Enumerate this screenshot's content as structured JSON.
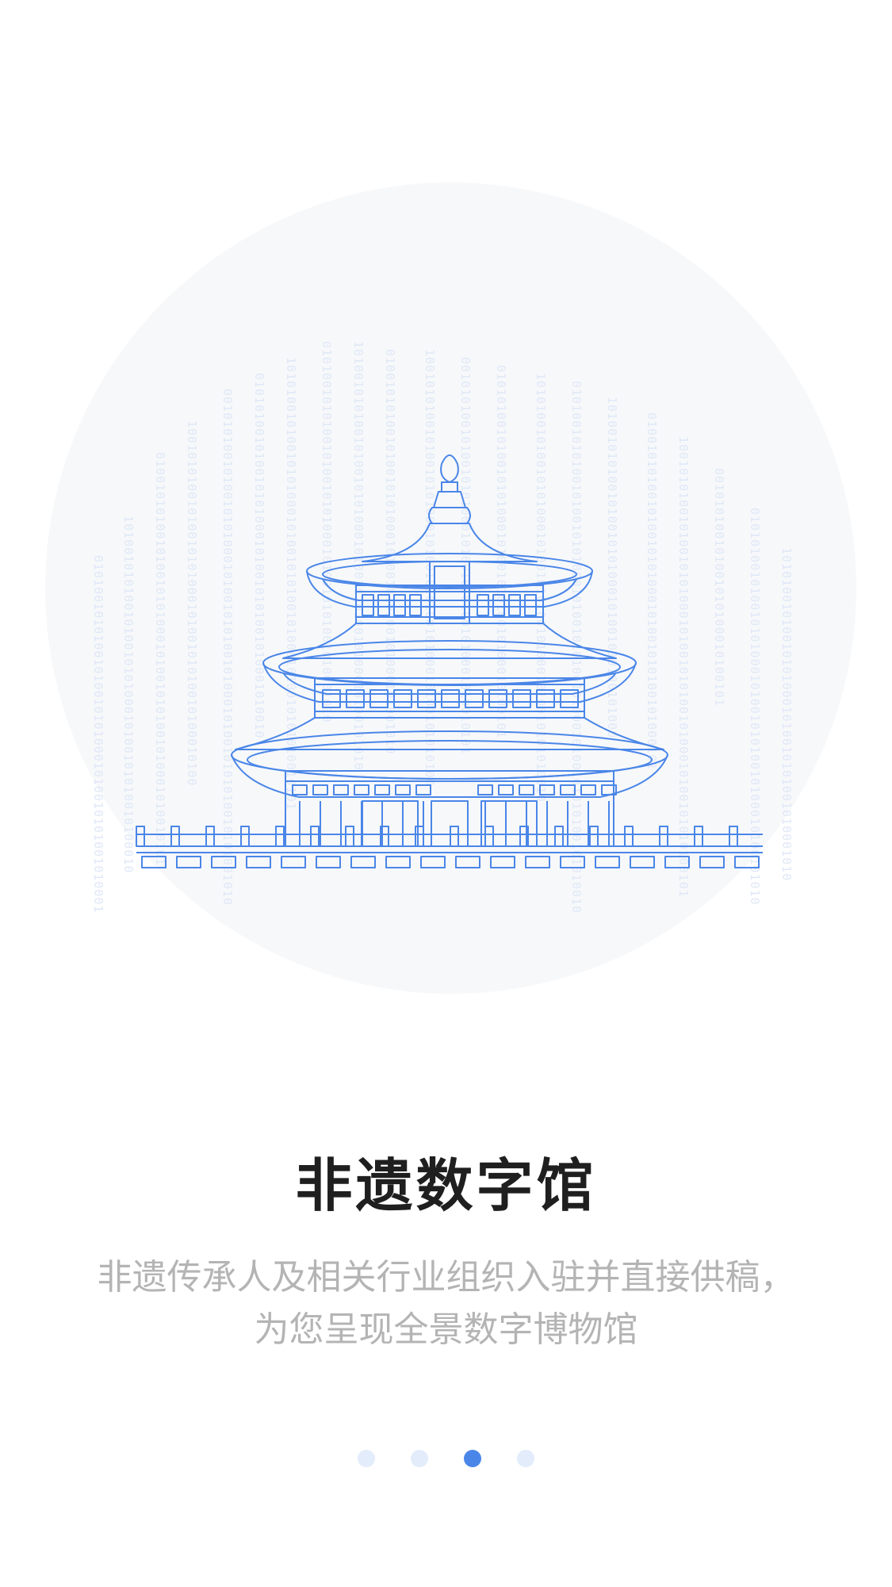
{
  "slide": {
    "title": "非遗数字馆",
    "subtitle_line1": "非遗传承人及相关行业组织入驻并直接供稿，",
    "subtitle_line2": "为您呈现全景数字博物馆"
  },
  "illustration": {
    "icon": "temple-of-heaven-illustration",
    "line_color": "#4a86e8",
    "circle_color": "#f7f8fa",
    "binary_color": "#dfe8f7",
    "binary_text": "0101001010100101001010100010100101010010100010100101"
  },
  "pagination": {
    "active_color": "#4a86e8",
    "inactive_color": "#e3ecfb",
    "dots": [
      {
        "active": false
      },
      {
        "active": false
      },
      {
        "active": true
      },
      {
        "active": false
      }
    ]
  }
}
